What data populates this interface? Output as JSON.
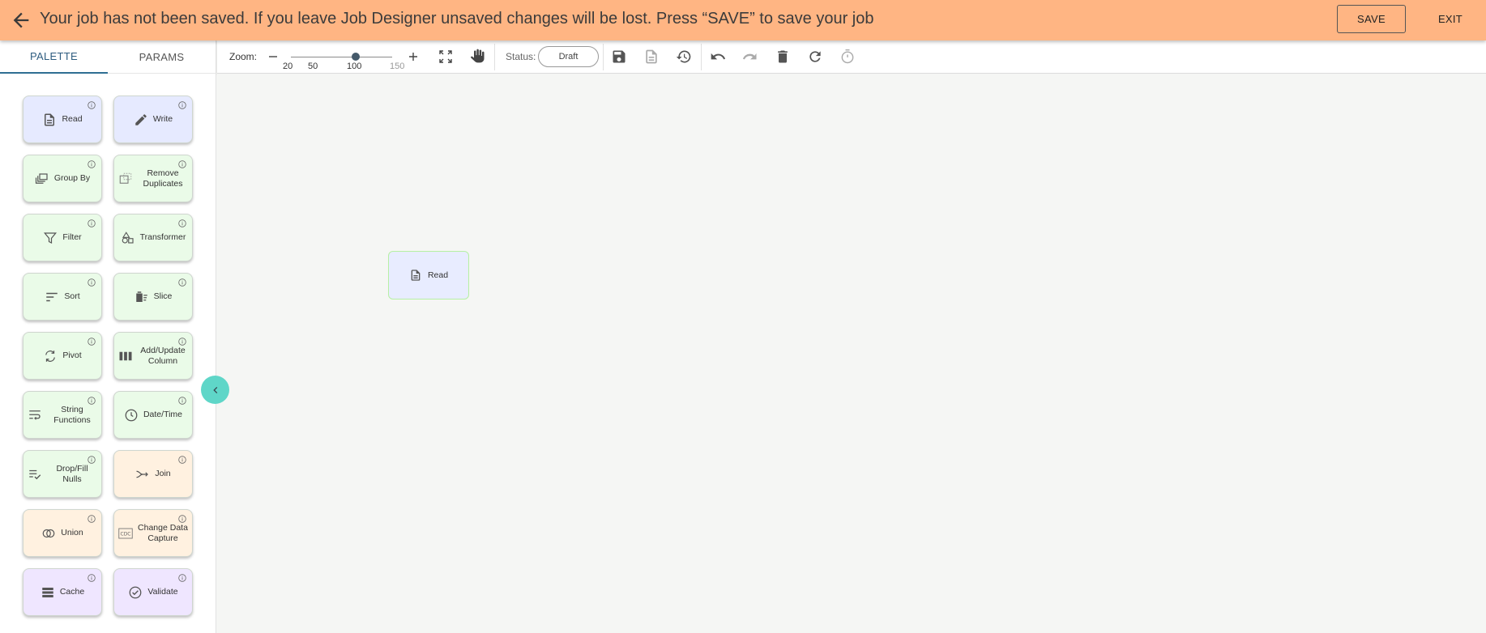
{
  "banner": {
    "message": "Your job has not been saved. If you leave Job Designer unsaved changes will be lost. Press “SAVE” to save your job",
    "save_label": "SAVE",
    "exit_label": "EXIT",
    "background": "#ffb583"
  },
  "tabs": [
    {
      "label": "PALETTE",
      "active": true
    },
    {
      "label": "PARAMS",
      "active": false
    }
  ],
  "palette": {
    "items": [
      {
        "label": "Read",
        "icon": "file-document-icon",
        "color": "#e6eaff"
      },
      {
        "label": "Write",
        "icon": "pencil-icon",
        "color": "#e6eaff"
      },
      {
        "label": "Group By",
        "icon": "group-by-icon",
        "color": "#eafbe8"
      },
      {
        "label": "Remove Duplicates",
        "icon": "remove-duplicates-icon",
        "color": "#eafbe8"
      },
      {
        "label": "Filter",
        "icon": "funnel-icon",
        "color": "#eafbe8"
      },
      {
        "label": "Transformer",
        "icon": "shapes-icon",
        "color": "#eafbe8"
      },
      {
        "label": "Sort",
        "icon": "sort-lines-icon",
        "color": "#eafbe8"
      },
      {
        "label": "Slice",
        "icon": "slice-icon",
        "color": "#eafbe8"
      },
      {
        "label": "Pivot",
        "icon": "pivot-arrows-icon",
        "color": "#eafbe8"
      },
      {
        "label": "Add/Update Column",
        "icon": "columns-icon",
        "color": "#eafbe8"
      },
      {
        "label": "String Functions",
        "icon": "wrap-text-icon",
        "color": "#eafbe8"
      },
      {
        "label": "Date/Time",
        "icon": "clock-icon",
        "color": "#eafbe8"
      },
      {
        "label": "Drop/Fill Nulls",
        "icon": "list-check-icon",
        "color": "#eafbe8"
      },
      {
        "label": "Join",
        "icon": "join-arrow-icon",
        "color": "#fff1e0"
      },
      {
        "label": "Union",
        "icon": "union-circles-icon",
        "color": "#fff1e0"
      },
      {
        "label": "Change Data Capture",
        "icon": "cdc-icon",
        "icon_text": "CDC",
        "color": "#fff1e0"
      },
      {
        "label": "Cache",
        "icon": "database-stack-icon",
        "color": "#efe6ff"
      },
      {
        "label": "Validate",
        "icon": "check-circle-icon",
        "color": "#efe6ff"
      }
    ]
  },
  "toolbar": {
    "zoom_label": "Zoom:",
    "zoom_ticks": [
      "20",
      "50",
      "100",
      "150"
    ],
    "zoom_value": 100,
    "status_label": "Status:",
    "status_value": "Draft",
    "icons": [
      "save-icon",
      "file-icon",
      "history-icon",
      "undo-icon",
      "redo-icon",
      "delete-icon",
      "refresh-icon",
      "timer-icon"
    ]
  },
  "canvas": {
    "nodes": [
      {
        "label": "Read",
        "icon": "file-document-icon"
      }
    ]
  }
}
